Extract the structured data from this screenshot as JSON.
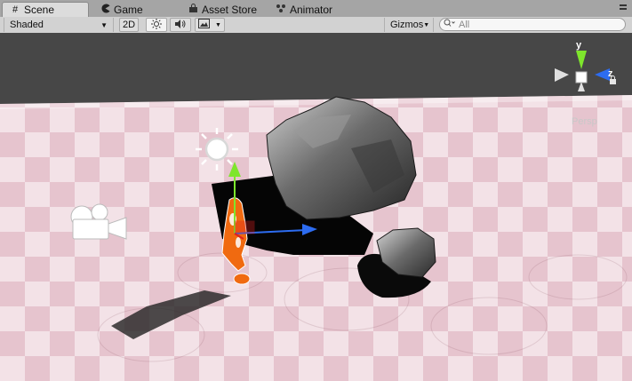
{
  "tabs": [
    {
      "label": "Scene",
      "icon": "hash-icon",
      "active": true
    },
    {
      "label": "Game",
      "icon": "pacman-icon",
      "active": false
    },
    {
      "label": "Asset Store",
      "icon": "bag-icon",
      "active": false
    },
    {
      "label": "Animator",
      "icon": "animator-icon",
      "active": false
    }
  ],
  "toolbar": {
    "shading_mode": "Shaded",
    "mode_2d_label": "2D",
    "gizmos_label": "Gizmos",
    "search_placeholder": "All"
  },
  "scene_gizmo": {
    "y_label": "y",
    "z_label": "z",
    "projection_label": "Persp"
  },
  "colors": {
    "sky": "#474747",
    "floor_light": "#f3e2e7",
    "floor_dark": "#e6c4ce",
    "axis_y": "#7ee62c",
    "axis_z": "#2d6cf0",
    "selection": "#f06a10"
  }
}
